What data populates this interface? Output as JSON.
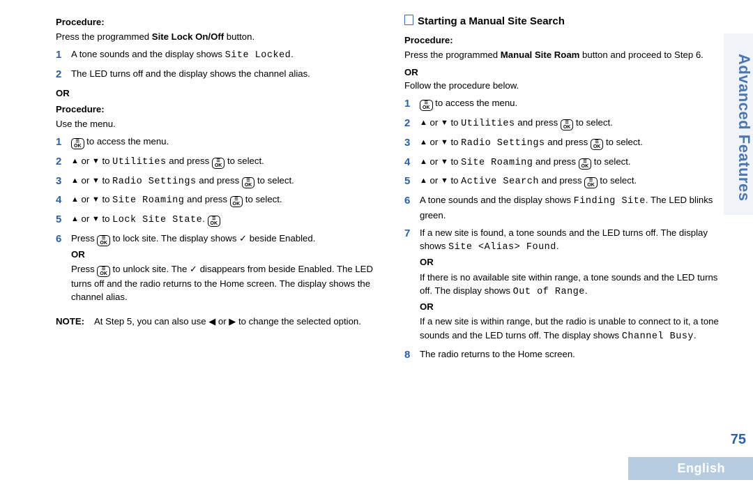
{
  "sideTab": "Advanced Features",
  "pageNumber": "75",
  "language": "English",
  "left": {
    "proc1Label": "Procedure:",
    "proc1Intro_a": "Press the programmed ",
    "proc1Intro_b": "Site Lock On/Off",
    "proc1Intro_c": " button.",
    "s1": {
      "n": "1",
      "a": "A tone sounds and the display shows ",
      "b": "Site Locked",
      "c": "."
    },
    "s2": {
      "n": "2",
      "a": "The LED turns off and the display shows the channel alias."
    },
    "or1": "OR",
    "proc2Label": "Procedure:",
    "proc2Intro": "Use the menu.",
    "m1": {
      "n": "1",
      "a": " to access the menu."
    },
    "m2": {
      "n": "2",
      "a": " or ",
      "b": " to ",
      "c": "Utilities",
      "d": " and press ",
      "e": " to select."
    },
    "m3": {
      "n": "3",
      "a": " or ",
      "b": " to ",
      "c": "Radio Settings",
      "d": " and press ",
      "e": " to select."
    },
    "m4": {
      "n": "4",
      "a": " or ",
      "b": " to ",
      "c": "Site Roaming",
      "d": " and press ",
      "e": " to select."
    },
    "m5": {
      "n": "5",
      "a": " or ",
      "b": " to ",
      "c": "Lock Site State",
      "d": ". "
    },
    "m6": {
      "n": "6",
      "a": "Press ",
      "b": " to lock site. The display shows ",
      "c": " beside Enabled.",
      "or": "OR",
      "d": "Press ",
      "e": " to unlock site. The ",
      "f": " disappears from beside Enabled. The LED turns off and the radio returns to the Home screen. The display shows the channel alias."
    },
    "noteLabel": "NOTE:",
    "noteBody_a": "At Step 5, you can also use ",
    "noteBody_b": " or ",
    "noteBody_c": " to change the selected option."
  },
  "right": {
    "sectionTitle": "Starting a Manual Site Search",
    "procLabel": "Procedure:",
    "intro_a": "Press the programmed ",
    "intro_b": "Manual Site Roam",
    "intro_c": " button and proceed to Step 6.",
    "or1": "OR",
    "intro2": "Follow the procedure below.",
    "r1": {
      "n": "1",
      "a": " to access the menu."
    },
    "r2": {
      "n": "2",
      "a": " or ",
      "b": " to ",
      "c": "Utilities",
      "d": " and press ",
      "e": " to select."
    },
    "r3": {
      "n": "3",
      "a": " or ",
      "b": " to ",
      "c": "Radio Settings",
      "d": " and press ",
      "e": " to select."
    },
    "r4": {
      "n": "4",
      "a": " or ",
      "b": " to ",
      "c": "Site Roaming",
      "d": " and press ",
      "e": " to select."
    },
    "r5": {
      "n": "5",
      "a": " or ",
      "b": " to ",
      "c": "Active Search",
      "d": " and press ",
      "e": " to select."
    },
    "r6": {
      "n": "6",
      "a": "A tone sounds and the display shows ",
      "b": "Finding Site",
      "c": ". The LED blinks green."
    },
    "r7": {
      "n": "7",
      "a": "If a new site is found, a tone sounds and the LED turns off. The display shows ",
      "b": "Site <Alias> Found",
      "c": ".",
      "or1": "OR",
      "d": "If there is no available site within range, a tone sounds and the LED turns off. The display shows ",
      "e": "Out of Range",
      "f": ".",
      "or2": "OR",
      "g": "If a new site is within range, but the radio is unable to connect to it, a tone sounds and the LED turns off. The display shows ",
      "h": "Channel Busy",
      "i": "."
    },
    "r8": {
      "n": "8",
      "a": "The radio returns to the Home screen."
    }
  }
}
